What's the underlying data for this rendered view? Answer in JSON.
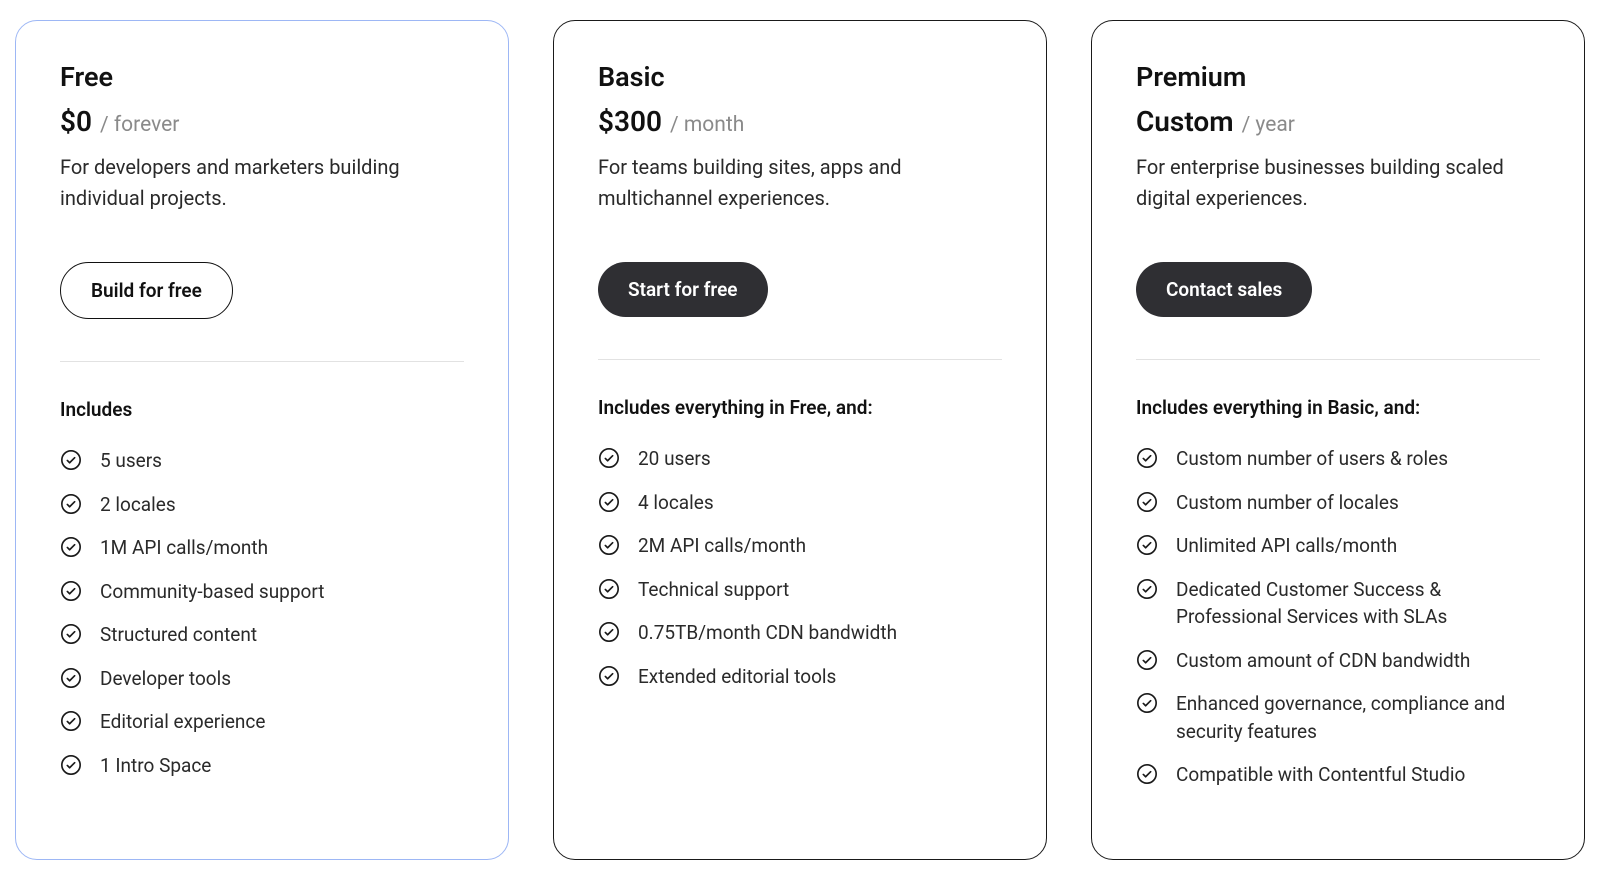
{
  "plans": [
    {
      "name": "Free",
      "price": "$0",
      "period": "/ forever",
      "description": "For developers and marketers building individual projects.",
      "cta": "Build for free",
      "cta_style": "outline",
      "highlighted": true,
      "includes_heading": "Includes",
      "features": [
        "5 users",
        "2 locales",
        "1M API calls/month",
        "Community-based support",
        "Structured content",
        "Developer tools",
        "Editorial experience",
        "1 Intro Space"
      ]
    },
    {
      "name": "Basic",
      "price": "$300",
      "period": "/ month",
      "description": "For teams building sites, apps and multichannel experiences.",
      "cta": "Start for free",
      "cta_style": "filled",
      "highlighted": false,
      "includes_heading": "Includes everything in Free, and:",
      "features": [
        "20 users",
        "4 locales",
        "2M API calls/month",
        "Technical support",
        "0.75TB/month CDN bandwidth",
        "Extended editorial tools"
      ]
    },
    {
      "name": "Premium",
      "price": "Custom",
      "period": "/ year",
      "description": "For enterprise businesses building scaled digital experiences.",
      "cta": "Contact sales",
      "cta_style": "filled",
      "highlighted": false,
      "includes_heading": "Includes everything in Basic, and:",
      "features": [
        "Custom number of users & roles",
        "Custom number of locales",
        "Unlimited API calls/month",
        "Dedicated Customer Success & Professional Services with SLAs",
        "Custom amount of CDN bandwidth",
        "Enhanced governance, compliance and security features",
        "Compatible with Contentful Studio"
      ]
    }
  ]
}
